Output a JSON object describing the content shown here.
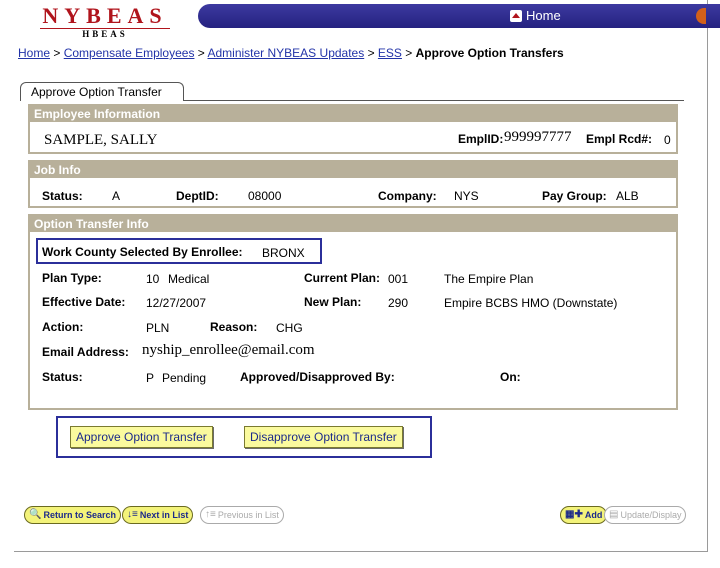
{
  "header": {
    "logo_main": "NYBEAS",
    "logo_sub": "HBEAS",
    "home_label": "Home"
  },
  "breadcrumb": {
    "items": [
      "Home",
      "Compensate Employees",
      "Administer NYBEAS Updates",
      "ESS"
    ],
    "separator": ">",
    "current": "Approve Option Transfers"
  },
  "tab": {
    "label": "Approve Option Transfer"
  },
  "employee": {
    "section_title": "Employee Information",
    "name": "SAMPLE, SALLY",
    "emplid_label": "EmplID:",
    "emplid": "999997777",
    "rcd_label": "Empl Rcd#:",
    "rcd": "0"
  },
  "job": {
    "section_title": "Job Info",
    "status_label": "Status:",
    "status": "A",
    "dept_label": "DeptID:",
    "dept": "08000",
    "company_label": "Company:",
    "company": "NYS",
    "paygroup_label": "Pay Group:",
    "paygroup": "ALB"
  },
  "transfer": {
    "section_title": "Option Transfer Info",
    "county_label": "Work County Selected By Enrollee:",
    "county": "BRONX",
    "plan_type_label": "Plan Type:",
    "plan_type_code": "10",
    "plan_type_name": "Medical",
    "current_plan_label": "Current Plan:",
    "current_plan_code": "001",
    "current_plan_name": "The Empire Plan",
    "effective_label": "Effective Date:",
    "effective_date": "12/27/2007",
    "new_plan_label": "New Plan:",
    "new_plan_code": "290",
    "new_plan_name": "Empire BCBS HMO (Downstate)",
    "action_label": "Action:",
    "action": "PLN",
    "reason_label": "Reason:",
    "reason": "CHG",
    "email_label": "Email Address:",
    "email": "nyship_enrollee@email.com",
    "status_label": "Status:",
    "status_code": "P",
    "status_text": "Pending",
    "approved_by_label": "Approved/Disapproved By:",
    "on_label": "On:"
  },
  "actions": {
    "approve": "Approve Option Transfer",
    "disapprove": "Disapprove Option Transfer"
  },
  "toolbar": {
    "return_search": "Return to Search",
    "next_in_list": "Next in List",
    "previous_in_list": "Previous in List",
    "add": "Add",
    "update_display": "Update/Display"
  }
}
